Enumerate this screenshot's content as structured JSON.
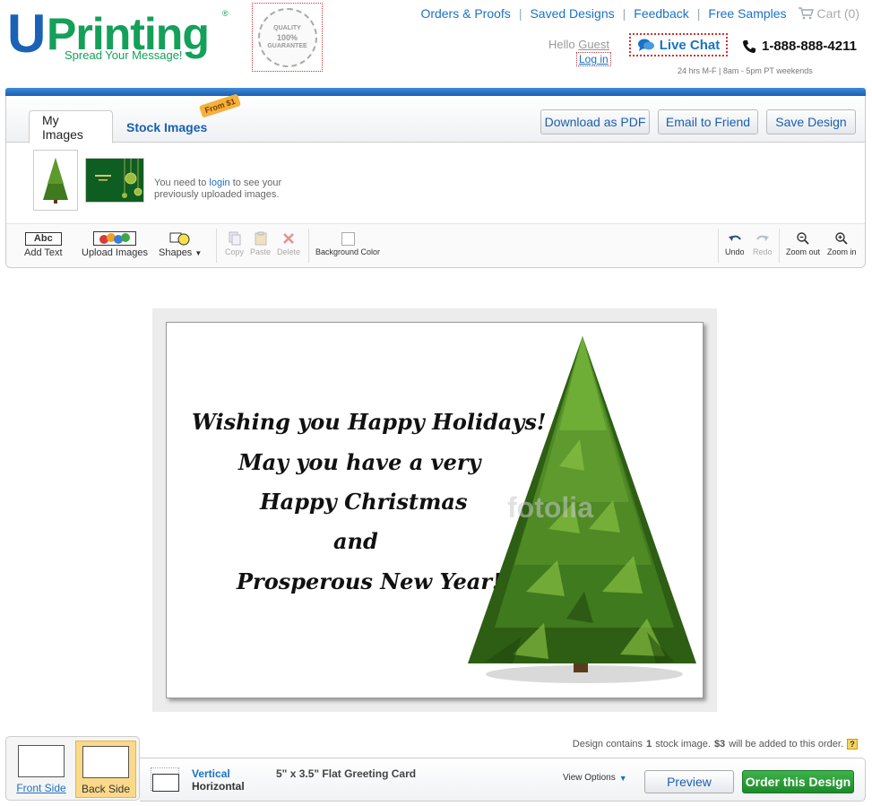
{
  "brand": {
    "logo_u": "U",
    "logo_rest": "Printing",
    "registered": "®",
    "tagline": "Spread Your Message!",
    "seal_lines": [
      "QUALITY",
      "100%",
      "GUARANTEE"
    ]
  },
  "top_nav": {
    "items": [
      "Orders & Proofs",
      "Saved Designs",
      "Feedback",
      "Free Samples"
    ],
    "cart": "Cart (0)"
  },
  "account": {
    "hello": "Hello",
    "guest": "Guest",
    "login": "Log in"
  },
  "support": {
    "live_chat": "Live Chat",
    "phone": "1-888-888-4211",
    "hours": "24 hrs M-F | 8am - 5pm PT weekends"
  },
  "tabs": {
    "my_images": "My Images",
    "stock_images": "Stock Images",
    "stock_badge": "From $1"
  },
  "actions": {
    "download_pdf": "Download as PDF",
    "email_friend": "Email to Friend",
    "save_design": "Save Design"
  },
  "images_panel": {
    "msg_before": "You need to",
    "msg_link": "login",
    "msg_after": "to see your previously uploaded images."
  },
  "toolbar": {
    "abc": "Abc",
    "add_text": "Add Text",
    "upload_images": "Upload Images",
    "shapes": "Shapes",
    "copy": "Copy",
    "paste": "Paste",
    "delete": "Delete",
    "background_color": "Background Color",
    "undo": "Undo",
    "redo": "Redo",
    "zoom_out": "Zoom out",
    "zoom_in": "Zoom in"
  },
  "card": {
    "lines": [
      "Wishing you Happy Holidays!",
      "May you have a very",
      "Happy Christmas",
      "and",
      "Prosperous New Year!"
    ],
    "watermark": "fotolia"
  },
  "footer": {
    "note_prefix": "Design contains",
    "note_count": "1",
    "note_mid": "stock image.",
    "note_price": "$3",
    "note_suffix": "will be added to this order.",
    "help": "?",
    "front_side": "Front Side",
    "back_side": "Back Side",
    "vertical": "Vertical",
    "horizontal": "Horizontal",
    "product": "5\" x 3.5\" Flat Greeting Card",
    "view_options": "View Options",
    "preview": "Preview",
    "order": "Order this Design"
  },
  "colors": {
    "brand_blue": "#1a62b5",
    "brand_green": "#15a05a",
    "link_blue": "#1a72c4",
    "order_green": "#2a9d35",
    "selected_side": "#fbd98a"
  }
}
